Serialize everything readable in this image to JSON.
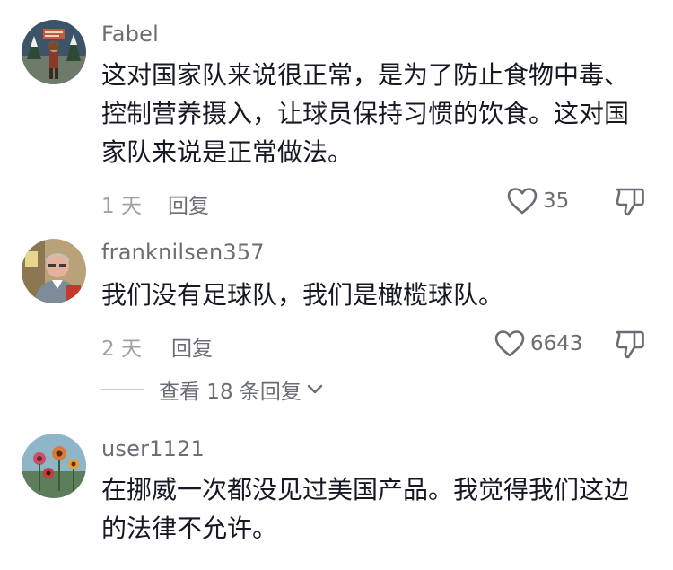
{
  "comments": [
    {
      "username": "Fabel",
      "text": "这对国家队来说很正常，是为了防止食物中毒、控制营养摄入，让球员保持习惯的饮食。这对国家队来说是正常做法。",
      "time": "1 天",
      "reply_label": "回复",
      "likes": "35",
      "avatar_icon": "avatar-fabel-illustration"
    },
    {
      "username": "franknilsen357",
      "text": "我们没有足球队，我们是橄榄球队。",
      "time": "2 天",
      "reply_label": "回复",
      "likes": "6643",
      "avatar_icon": "avatar-photo-man"
    },
    {
      "username": "user1121",
      "text": "在挪威一次都没见过美国产品。我觉得我们这边的法律不允许。",
      "time": "",
      "reply_label": "",
      "likes": "",
      "avatar_icon": "avatar-flowers"
    }
  ],
  "view_replies": {
    "label": "查看 18 条回复",
    "icon": "chevron-down-icon"
  },
  "icons": {
    "like": "heart-outline-icon",
    "dislike": "thumbs-down-outline-icon"
  },
  "colors": {
    "text_primary": "#161823",
    "text_secondary": "#6b6d75",
    "text_muted": "#a0a1a6"
  }
}
